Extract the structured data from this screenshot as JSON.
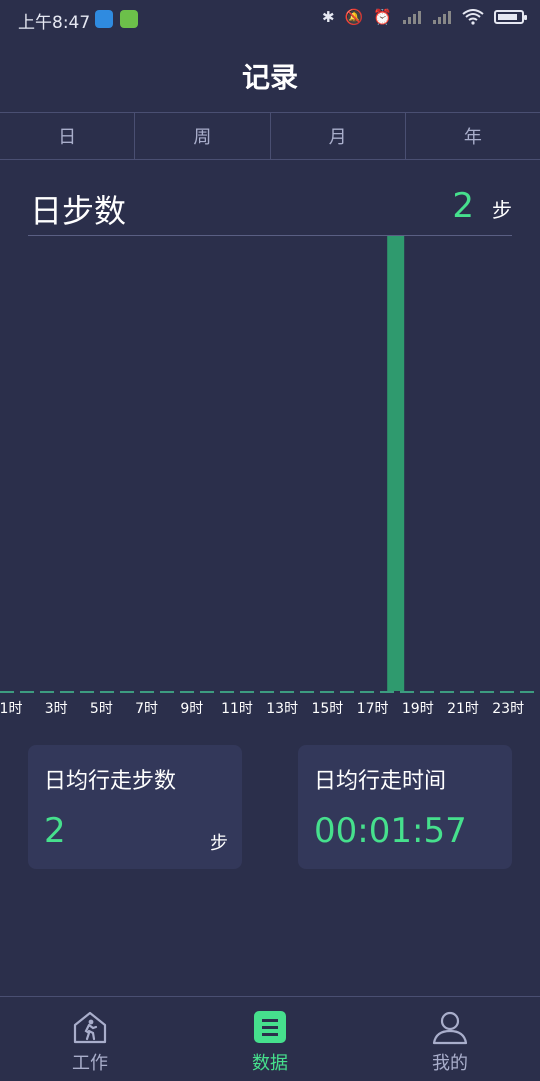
{
  "status_bar": {
    "time": "上午8:47",
    "battery_level": 0.85
  },
  "header": {
    "title": "记录"
  },
  "tabs": [
    {
      "label": "日",
      "active": true
    },
    {
      "label": "周",
      "active": false
    },
    {
      "label": "月",
      "active": false
    },
    {
      "label": "年",
      "active": false
    }
  ],
  "steps_header": {
    "title": "日步数",
    "value": "2",
    "unit": "步"
  },
  "chart_data": {
    "type": "bar",
    "x_tick_labels": [
      "1时",
      "3时",
      "5时",
      "7时",
      "9时",
      "11时",
      "13时",
      "15时",
      "17时",
      "19时",
      "21时",
      "23时"
    ],
    "hours": [
      0,
      1,
      2,
      3,
      4,
      5,
      6,
      7,
      8,
      9,
      10,
      11,
      12,
      13,
      14,
      15,
      16,
      17,
      18,
      19,
      20,
      21,
      22,
      23
    ],
    "values": [
      0,
      0,
      0,
      0,
      0,
      0,
      0,
      0,
      0,
      0,
      0,
      0,
      0,
      0,
      0,
      0,
      0,
      0,
      2,
      0,
      0,
      0,
      0,
      0
    ],
    "bar_color": "#2f9a6e",
    "baseline_color": "#3d9c80"
  },
  "cards": [
    {
      "title": "日均行走步数",
      "value": "2",
      "unit": "步"
    },
    {
      "title": "日均行走时间",
      "value": "00:01:57",
      "unit": ""
    }
  ],
  "bottom_nav": [
    {
      "label": "工作",
      "icon": "home-walk-icon",
      "active": false
    },
    {
      "label": "数据",
      "icon": "list-icon",
      "active": true
    },
    {
      "label": "我的",
      "icon": "user-icon",
      "active": false
    }
  ],
  "colors": {
    "accent": "#46e08d",
    "background": "#2b2f4b",
    "card": "#33385a"
  }
}
